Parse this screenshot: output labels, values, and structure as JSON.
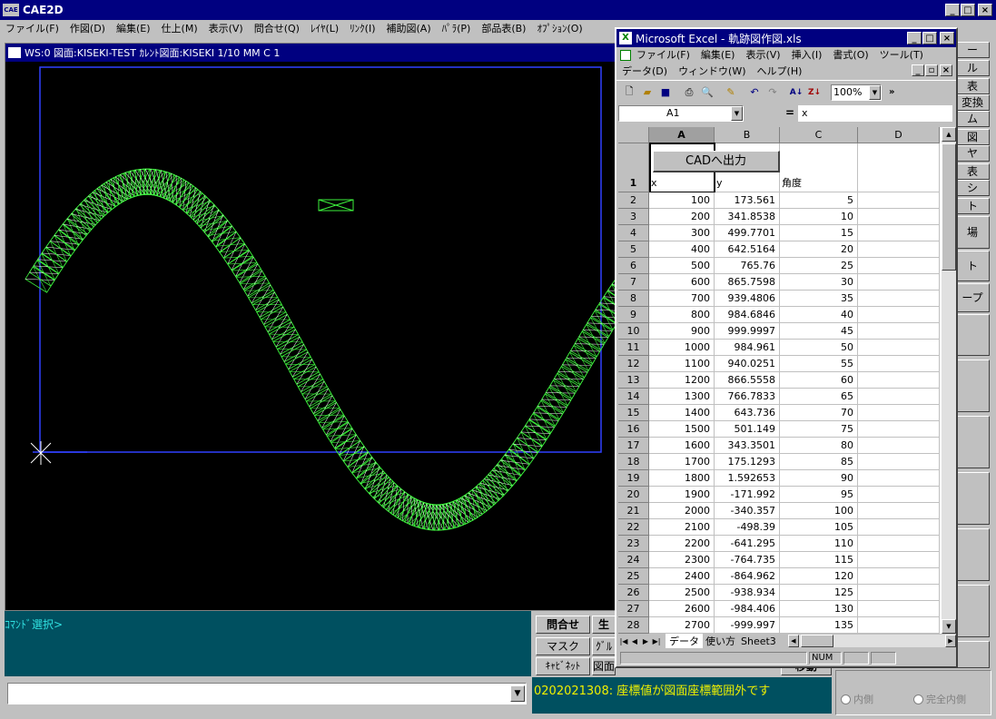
{
  "app": {
    "title": "CAE2D",
    "logo": "CAE",
    "menu": [
      "ファイル(F)",
      "作図(D)",
      "編集(E)",
      "仕上(M)",
      "表示(V)",
      "問合せ(Q)",
      "ﾚｲﾔ(L)",
      "ﾘﾝｸ(I)",
      "補助図(A)",
      "ﾊﾟﾗ(P)",
      "部品表(B)",
      "ｵﾌﾟｼｮﾝ(O)"
    ]
  },
  "workspace": {
    "title": "WS:0 図面:KISEKI-TEST ｶﾚﾝﾄ図面:KISEKI 1/10 MM C 1"
  },
  "command": {
    "prompt": "ｺﾏﾝﾄﾞ選択>",
    "status_message": "0202021308: 座標値が図面座標範囲外です",
    "buttons": [
      "問合せ",
      "生",
      "マスク",
      "ｸﾞﾙ",
      "ｷｬﾋﾞﾈｯﾄ",
      "図面",
      "移動"
    ]
  },
  "right_panel": {
    "buttons": [
      "ー",
      "ル",
      "表",
      "変換",
      "ム",
      "図",
      "ヤ",
      "表",
      "シ",
      "ト",
      "場",
      "ト",
      "ープ"
    ],
    "radio_inner": "内側",
    "radio_full": "完全内側"
  },
  "excel": {
    "title": "Microsoft Excel - 軌跡図作図.xls",
    "menu_row1": [
      "ファイル(F)",
      "編集(E)",
      "表示(V)",
      "挿入(I)",
      "書式(O)",
      "ツール(T)"
    ],
    "menu_row2": [
      "データ(D)",
      "ウィンドウ(W)",
      "ヘルプ(H)"
    ],
    "zoom": "100%",
    "name_box": "A1",
    "formula": "x",
    "col_headers": [
      "A",
      "B",
      "C",
      "D"
    ],
    "button_label": "CADへ出力",
    "header_row": {
      "num": "1",
      "a": "x",
      "b": "y",
      "c": "角度"
    },
    "rows": [
      {
        "n": "2",
        "x": "100",
        "y": "173.561",
        "a": "5"
      },
      {
        "n": "3",
        "x": "200",
        "y": "341.8538",
        "a": "10"
      },
      {
        "n": "4",
        "x": "300",
        "y": "499.7701",
        "a": "15"
      },
      {
        "n": "5",
        "x": "400",
        "y": "642.5164",
        "a": "20"
      },
      {
        "n": "6",
        "x": "500",
        "y": "765.76",
        "a": "25"
      },
      {
        "n": "7",
        "x": "600",
        "y": "865.7598",
        "a": "30"
      },
      {
        "n": "8",
        "x": "700",
        "y": "939.4806",
        "a": "35"
      },
      {
        "n": "9",
        "x": "800",
        "y": "984.6846",
        "a": "40"
      },
      {
        "n": "10",
        "x": "900",
        "y": "999.9997",
        "a": "45"
      },
      {
        "n": "11",
        "x": "1000",
        "y": "984.961",
        "a": "50"
      },
      {
        "n": "12",
        "x": "1100",
        "y": "940.0251",
        "a": "55"
      },
      {
        "n": "13",
        "x": "1200",
        "y": "866.5558",
        "a": "60"
      },
      {
        "n": "14",
        "x": "1300",
        "y": "766.7833",
        "a": "65"
      },
      {
        "n": "15",
        "x": "1400",
        "y": "643.736",
        "a": "70"
      },
      {
        "n": "16",
        "x": "1500",
        "y": "501.149",
        "a": "75"
      },
      {
        "n": "17",
        "x": "1600",
        "y": "343.3501",
        "a": "80"
      },
      {
        "n": "18",
        "x": "1700",
        "y": "175.1293",
        "a": "85"
      },
      {
        "n": "19",
        "x": "1800",
        "y": "1.592653",
        "a": "90"
      },
      {
        "n": "20",
        "x": "1900",
        "y": "-171.992",
        "a": "95"
      },
      {
        "n": "21",
        "x": "2000",
        "y": "-340.357",
        "a": "100"
      },
      {
        "n": "22",
        "x": "2100",
        "y": "-498.39",
        "a": "105"
      },
      {
        "n": "23",
        "x": "2200",
        "y": "-641.295",
        "a": "110"
      },
      {
        "n": "24",
        "x": "2300",
        "y": "-764.735",
        "a": "115"
      },
      {
        "n": "25",
        "x": "2400",
        "y": "-864.962",
        "a": "120"
      },
      {
        "n": "26",
        "x": "2500",
        "y": "-938.934",
        "a": "125"
      },
      {
        "n": "27",
        "x": "2600",
        "y": "-984.406",
        "a": "130"
      },
      {
        "n": "28",
        "x": "2700",
        "y": "-999.997",
        "a": "135"
      }
    ],
    "sheet_tabs": [
      "データ",
      "使い方",
      "Sheet3"
    ],
    "status": "NUM"
  }
}
